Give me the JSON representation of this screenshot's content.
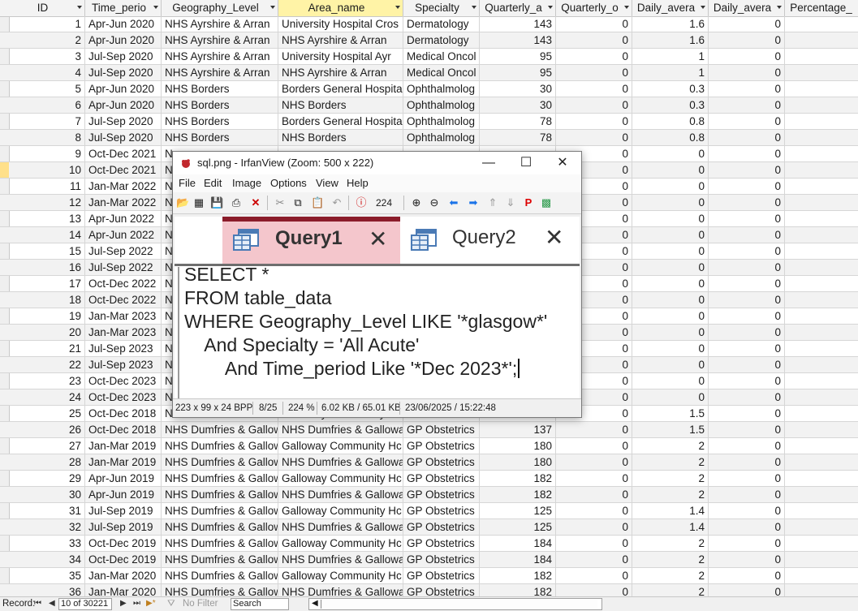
{
  "columns": [
    "ID",
    "Time_perio",
    "Geography_Level",
    "Area_name",
    "Specialty",
    "Quarterly_a",
    "Quarterly_o",
    "Daily_avera",
    "Daily_avera",
    "Percentage_"
  ],
  "rows": [
    [
      "1",
      "Apr-Jun 2020",
      "NHS Ayrshire & Arran",
      "University Hospital Cros",
      "Dermatology",
      "143",
      "0",
      "1.6",
      "0",
      ""
    ],
    [
      "2",
      "Apr-Jun 2020",
      "NHS Ayrshire & Arran",
      "NHS Ayrshire & Arran",
      "Dermatology",
      "143",
      "0",
      "1.6",
      "0",
      ""
    ],
    [
      "3",
      "Jul-Sep 2020",
      "NHS Ayrshire & Arran",
      "University Hospital Ayr",
      "Medical Oncol",
      "95",
      "0",
      "1",
      "0",
      ""
    ],
    [
      "4",
      "Jul-Sep 2020",
      "NHS Ayrshire & Arran",
      "NHS Ayrshire & Arran",
      "Medical Oncol",
      "95",
      "0",
      "1",
      "0",
      ""
    ],
    [
      "5",
      "Apr-Jun 2020",
      "NHS Borders",
      "Borders General Hospita",
      "Ophthalmolog",
      "30",
      "0",
      "0.3",
      "0",
      ""
    ],
    [
      "6",
      "Apr-Jun 2020",
      "NHS Borders",
      "NHS Borders",
      "Ophthalmolog",
      "30",
      "0",
      "0.3",
      "0",
      ""
    ],
    [
      "7",
      "Jul-Sep 2020",
      "NHS Borders",
      "Borders General Hospita",
      "Ophthalmolog",
      "78",
      "0",
      "0.8",
      "0",
      ""
    ],
    [
      "8",
      "Jul-Sep 2020",
      "NHS Borders",
      "NHS Borders",
      "Ophthalmolog",
      "78",
      "0",
      "0.8",
      "0",
      ""
    ],
    [
      "9",
      "Oct-Dec 2021",
      "N",
      "",
      "",
      "",
      "0",
      "0",
      "0",
      ""
    ],
    [
      "10",
      "Oct-Dec 2021",
      "N",
      "",
      "",
      "",
      "0",
      "0",
      "0",
      ""
    ],
    [
      "11",
      "Jan-Mar 2022",
      "N",
      "",
      "",
      "",
      "0",
      "0",
      "0",
      ""
    ],
    [
      "12",
      "Jan-Mar 2022",
      "N",
      "",
      "",
      "",
      "0",
      "0",
      "0",
      ""
    ],
    [
      "13",
      "Apr-Jun 2022",
      "N",
      "",
      "",
      "",
      "0",
      "0",
      "0",
      ""
    ],
    [
      "14",
      "Apr-Jun 2022",
      "N",
      "",
      "",
      "",
      "0",
      "0",
      "0",
      ""
    ],
    [
      "15",
      "Jul-Sep 2022",
      "N",
      "",
      "",
      "",
      "0",
      "0",
      "0",
      ""
    ],
    [
      "16",
      "Jul-Sep 2022",
      "N",
      "",
      "",
      "",
      "0",
      "0",
      "0",
      ""
    ],
    [
      "17",
      "Oct-Dec 2022",
      "N",
      "",
      "",
      "",
      "0",
      "0",
      "0",
      ""
    ],
    [
      "18",
      "Oct-Dec 2022",
      "N",
      "",
      "",
      "",
      "0",
      "0",
      "0",
      ""
    ],
    [
      "19",
      "Jan-Mar 2023",
      "N",
      "",
      "",
      "",
      "0",
      "0",
      "0",
      ""
    ],
    [
      "20",
      "Jan-Mar 2023",
      "N",
      "",
      "",
      "",
      "0",
      "0",
      "0",
      ""
    ],
    [
      "21",
      "Jul-Sep 2023",
      "N",
      "",
      "",
      "",
      "0",
      "0",
      "0",
      ""
    ],
    [
      "22",
      "Jul-Sep 2023",
      "N",
      "",
      "",
      "",
      "0",
      "0",
      "0",
      ""
    ],
    [
      "23",
      "Oct-Dec 2023",
      "N",
      "",
      "",
      "",
      "0",
      "0",
      "0",
      ""
    ],
    [
      "24",
      "Oct-Dec 2023",
      "N",
      "",
      "",
      "",
      "0",
      "0",
      "0",
      ""
    ],
    [
      "25",
      "Oct-Dec 2018",
      "NHS Dumfries & Gallow",
      "Galloway Community Hc",
      "GP Obstetrics",
      "137",
      "0",
      "1.5",
      "0",
      ""
    ],
    [
      "26",
      "Oct-Dec 2018",
      "NHS Dumfries & Gallow",
      "NHS Dumfries & Gallowa",
      "GP Obstetrics",
      "137",
      "0",
      "1.5",
      "0",
      ""
    ],
    [
      "27",
      "Jan-Mar 2019",
      "NHS Dumfries & Gallow",
      "Galloway Community Hc",
      "GP Obstetrics",
      "180",
      "0",
      "2",
      "0",
      ""
    ],
    [
      "28",
      "Jan-Mar 2019",
      "NHS Dumfries & Gallow",
      "NHS Dumfries & Gallowa",
      "GP Obstetrics",
      "180",
      "0",
      "2",
      "0",
      ""
    ],
    [
      "29",
      "Apr-Jun 2019",
      "NHS Dumfries & Gallow",
      "Galloway Community Hc",
      "GP Obstetrics",
      "182",
      "0",
      "2",
      "0",
      ""
    ],
    [
      "30",
      "Apr-Jun 2019",
      "NHS Dumfries & Gallow",
      "NHS Dumfries & Gallowa",
      "GP Obstetrics",
      "182",
      "0",
      "2",
      "0",
      ""
    ],
    [
      "31",
      "Jul-Sep 2019",
      "NHS Dumfries & Gallow",
      "Galloway Community Hc",
      "GP Obstetrics",
      "125",
      "0",
      "1.4",
      "0",
      ""
    ],
    [
      "32",
      "Jul-Sep 2019",
      "NHS Dumfries & Gallow",
      "NHS Dumfries & Gallowa",
      "GP Obstetrics",
      "125",
      "0",
      "1.4",
      "0",
      ""
    ],
    [
      "33",
      "Oct-Dec 2019",
      "NHS Dumfries & Gallow",
      "Galloway Community Hc",
      "GP Obstetrics",
      "184",
      "0",
      "2",
      "0",
      ""
    ],
    [
      "34",
      "Oct-Dec 2019",
      "NHS Dumfries & Gallow",
      "NHS Dumfries & Gallowa",
      "GP Obstetrics",
      "184",
      "0",
      "2",
      "0",
      ""
    ],
    [
      "35",
      "Jan-Mar 2020",
      "NHS Dumfries & Gallow",
      "Galloway Community Hc",
      "GP Obstetrics",
      "182",
      "0",
      "2",
      "0",
      ""
    ],
    [
      "36",
      "Jan-Mar 2020",
      "NHS Dumfries & Gallow",
      "NHS Dumfries & Gallowa",
      "GP Obstetrics",
      "182",
      "0",
      "2",
      "0",
      ""
    ]
  ],
  "status": {
    "record_label": "Record:",
    "record_value": "10 of 30221",
    "nav_first": "⏮",
    "nav_prev": "◀",
    "nav_next": "▶",
    "nav_last": "⏭",
    "nav_new": "▶*",
    "filter_label": "No Filter",
    "search_label": "Search",
    "scroll_left": "◀"
  },
  "viewer": {
    "title": "sql.png - IrfanView (Zoom: 500 x 222)",
    "minimize": "—",
    "maximize": "☐",
    "close": "✕",
    "menu": [
      "File",
      "Edit",
      "Image",
      "Options",
      "View",
      "Help"
    ],
    "zoom_value": "224",
    "status": [
      "223 x 99 x 24 BPP",
      "8/25",
      "224 %",
      "6.02 KB / 65.01 KB",
      "23/06/2025 / 15:22:48"
    ],
    "image": {
      "tab1": "Query1",
      "tab2": "Query2",
      "tab_close": "✕",
      "sql_lines": [
        "SELECT *",
        "FROM table_data",
        "WHERE Geography_Level LIKE '*glasgow*'",
        "    And Specialty = 'All Acute'",
        "        And Time_period Like '*Dec 2023*';"
      ]
    }
  },
  "colors": {
    "accent_tab": "#f4c6cc",
    "tab_border": "#8b1c2a",
    "selected_header": "#fff3a6"
  }
}
